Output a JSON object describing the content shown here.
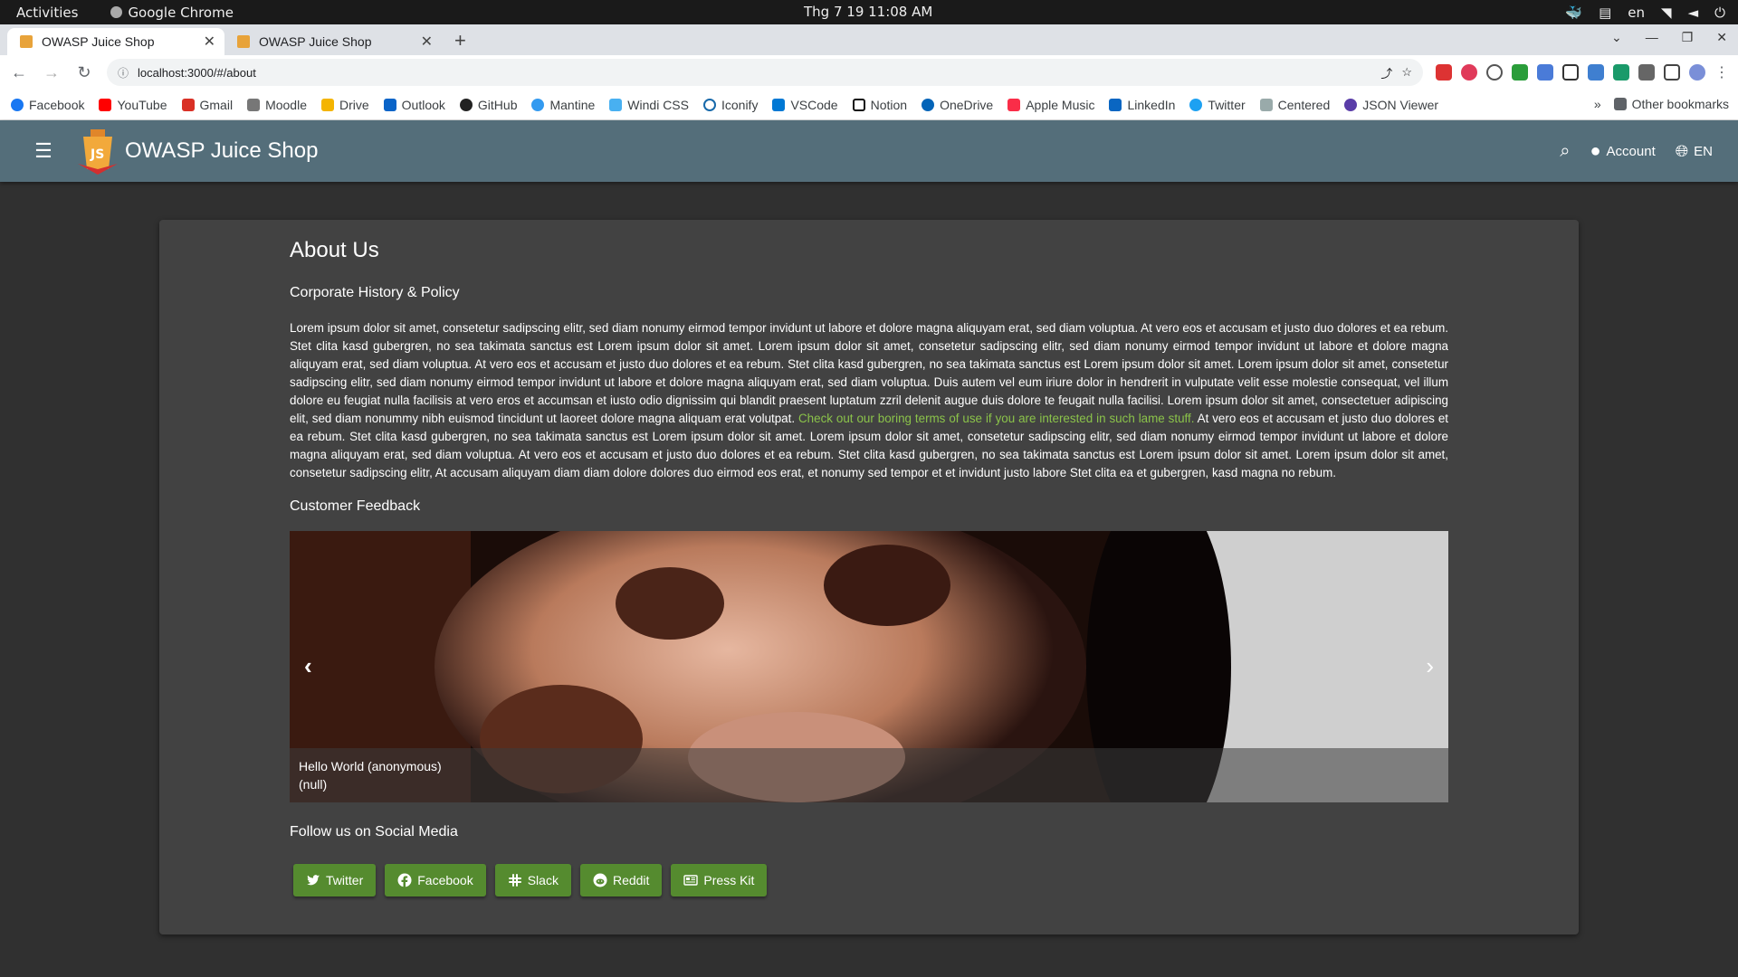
{
  "os": {
    "activities": "Activities",
    "app_name": "Google Chrome",
    "clock": "Thg 7 19  11:08 AM",
    "lang": "en"
  },
  "browser": {
    "tabs": [
      {
        "title": "OWASP Juice Shop"
      },
      {
        "title": "OWASP Juice Shop"
      }
    ],
    "url": "localhost:3000/#/about",
    "bookmarks": [
      "Facebook",
      "YouTube",
      "Gmail",
      "Moodle",
      "Drive",
      "Outlook",
      "GitHub",
      "Mantine",
      "Windi CSS",
      "Iconify",
      "VSCode",
      "Notion",
      "OneDrive",
      "Apple Music",
      "LinkedIn",
      "Twitter",
      "Centered",
      "JSON Viewer"
    ],
    "other_bookmarks": "Other bookmarks"
  },
  "app": {
    "title": "OWASP Juice Shop",
    "account": "Account",
    "language": "EN"
  },
  "about": {
    "title": "About Us",
    "subtitle": "Corporate History & Policy",
    "paragraph_part1": "Lorem ipsum dolor sit amet, consetetur sadipscing elitr, sed diam nonumy eirmod tempor invidunt ut labore et dolore magna aliquyam erat, sed diam voluptua. At vero eos et accusam et justo duo dolores et ea rebum. Stet clita kasd gubergren, no sea takimata sanctus est Lorem ipsum dolor sit amet. Lorem ipsum dolor sit amet, consetetur sadipscing elitr, sed diam nonumy eirmod tempor invidunt ut labore et dolore magna aliquyam erat, sed diam voluptua. At vero eos et accusam et justo duo dolores et ea rebum. Stet clita kasd gubergren, no sea takimata sanctus est Lorem ipsum dolor sit amet. Lorem ipsum dolor sit amet, consetetur sadipscing elitr, sed diam nonumy eirmod tempor invidunt ut labore et dolore magna aliquyam erat, sed diam voluptua. Duis autem vel eum iriure dolor in hendrerit in vulputate velit esse molestie consequat, vel illum dolore eu feugiat nulla facilisis at vero eros et accumsan et iusto odio dignissim qui blandit praesent luptatum zzril delenit augue duis dolore te feugait nulla facilisi. Lorem ipsum dolor sit amet, consectetuer adipiscing elit, sed diam nonummy nibh euismod tincidunt ut laoreet dolore magna aliquam erat volutpat. ",
    "link_text": "Check out our boring terms of use if you are interested in such lame stuff.",
    "paragraph_part2": " At vero eos et accusam et justo duo dolores et ea rebum. Stet clita kasd gubergren, no sea takimata sanctus est Lorem ipsum dolor sit amet. Lorem ipsum dolor sit amet, consetetur sadipscing elitr, sed diam nonumy eirmod tempor invidunt ut labore et dolore magna aliquyam erat, sed diam voluptua. At vero eos et accusam et justo duo dolores et ea rebum. Stet clita kasd gubergren, no sea takimata sanctus est Lorem ipsum dolor sit amet. Lorem ipsum dolor sit amet, consetetur sadipscing elitr, At accusam aliquyam diam diam dolore dolores duo eirmod eos erat, et nonumy sed tempor et et invidunt justo labore Stet clita ea et gubergren, kasd magna no rebum.",
    "feedback_title": "Customer Feedback",
    "feedback_caption_line1": "Hello World (anonymous)",
    "feedback_caption_line2": "(null)",
    "social_title": "Follow us on Social Media",
    "social_buttons": [
      "Twitter",
      "Facebook",
      "Slack",
      "Reddit",
      "Press Kit"
    ]
  },
  "colors": {
    "toolbar": "#546e7a",
    "accent": "#558b2f",
    "link": "#8bc34a"
  }
}
